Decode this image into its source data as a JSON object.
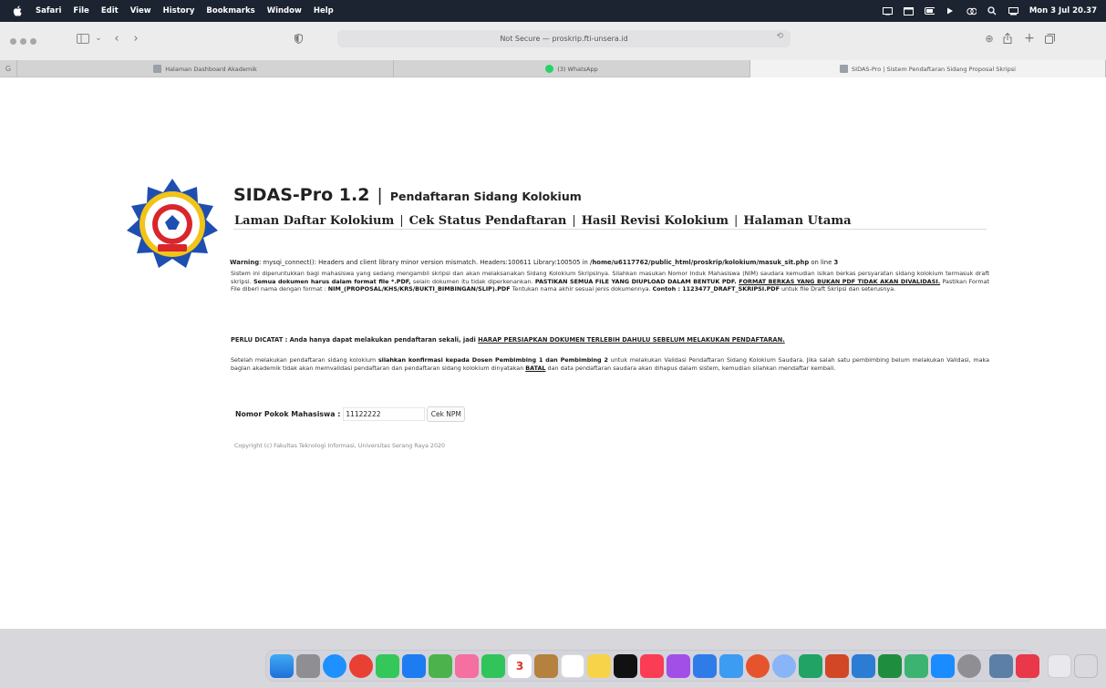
{
  "menubar": {
    "app": "Safari",
    "items": [
      "File",
      "Edit",
      "View",
      "History",
      "Bookmarks",
      "Window",
      "Help"
    ],
    "clock": "Mon 3 Jul 20.37"
  },
  "toolbar": {
    "url": "Not Secure — proskrip.fti-unsera.id"
  },
  "tabs": [
    {
      "label": "Halaman Dashboard Akademik"
    },
    {
      "label": "(3) WhatsApp"
    },
    {
      "label": "SIDAS-Pro | Sistem Pendaftaran Sidang Proposal Skripsi"
    }
  ],
  "page": {
    "title_main": "SIDAS-Pro 1.2",
    "title_sep": "|",
    "title_sub": "Pendaftaran Sidang Kolokium",
    "nav": [
      "Laman Daftar Kolokium",
      "Cek Status Pendaftaran",
      "Hasil Revisi Kolokium",
      "Halaman Utama"
    ],
    "nav_sep": "|",
    "warning_label": "Warning",
    "warning_text": ": mysqi_connect(): Headers and client library minor version mismatch. Headers:100611 Library:100505 in ",
    "warning_path": "/home/u6117762/public_html/proskrip/kolokium/masuk_sit.php",
    "warning_line_text": " on line ",
    "warning_line": "3",
    "para1": {
      "t1": "Sistem ini diperuntukkan bagi mahasiswa yang sedang mengambil skripsi dan akan melaksanakan Sidang Kolokium Skripsinya. Silahkan masukan Nomor Induk Mahasiswa (NIM) saudara kemudian isikan berkas persyaratan sidang kolokium termasuk draft skripsi. ",
      "b1": "Semua dokumen harus dalam format file *.PDF,",
      "t2": " selain dokumen itu tidak diperkenankan. ",
      "b2": "PASTIKAN SEMUA FILE YANG DIUPLOAD DALAM BENTUK PDF. ",
      "u1": "FORMAT BERKAS YANG BUKAN PDF TIDAK AKAN DIVALIDASI.",
      "t3": " Pastikan Format File diberi nama dengan format : ",
      "b3": "NIM_(PROPOSAL/KHS/KRS/BUKTI_BIMBINGAN/SLIP).PDF",
      "t4": " Tentukan nama akhir sesuai jenis dokumennya. ",
      "b4": "Contoh : 1123477_DRAFT_SKRIPSI.PDF",
      "t5": " untuk file Draft Skripsi dan seterusnya."
    },
    "para2": {
      "t1": "PERLU DICATAT : Anda hanya dapat melakukan pendaftaran sekali, jadi ",
      "u1": "HARAP PERSIAPKAN DOKUMEN TERLEBIH DAHULU SEBELUM MELAKUKAN PENDAFTARAN."
    },
    "para3": {
      "t1": "Setelah melakukan pendaftaran sidang kolokium ",
      "b1": "silahkan konfirmasi kepada Dosen Pembimbing 1 dan Pembimbing 2",
      "t2": " untuk melakukan Validasi Pendaftaran Sidang Kolokium Saudara. Jika salah satu pembimbing belum melakukan Validasi, maka bagian akademik tidak akan memvalidasi pendaftaran dan pendaftaran sidang kolokium dinyatakan ",
      "b2": "BATAL",
      "t3": " dan data pendaftaran saudara akan dihapus dalam sistem, kemudian silahkan mendaftar kembali."
    },
    "form": {
      "label": "Nomor Pokok Mahasiswa :",
      "value": "11122222",
      "button": "Cek NPM"
    },
    "copyright": "Copyright (c) Fakultas Teknologi Informasi, Universitas Serang Raya 2020"
  },
  "dock": {
    "calendar_day": "3"
  },
  "colors": {
    "menubar": "#1c2331",
    "logo_blue": "#1e4fb0",
    "logo_yellow": "#f2c418",
    "logo_red": "#d8262c"
  }
}
